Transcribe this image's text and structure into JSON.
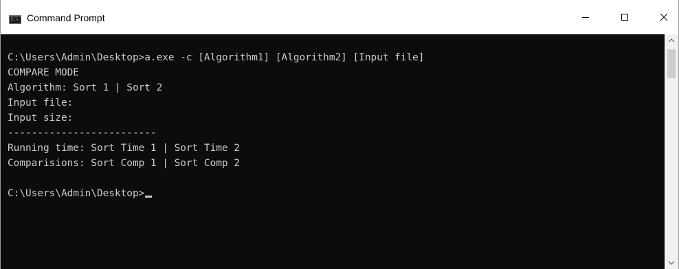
{
  "window": {
    "title": "Command Prompt",
    "icon": "console-icon",
    "icon_text": "C:\\",
    "controls": [
      "minimize-icon",
      "maximize-icon",
      "close-icon"
    ]
  },
  "console": {
    "lines": [
      "C:\\Users\\Admin\\Desktop>a.exe -c [Algorithm1] [Algorithm2] [Input file]",
      "COMPARE MODE",
      "Algorithm: Sort 1 | Sort 2",
      "Input file:",
      "Input size:",
      "-------------------------",
      "Running time: Sort Time 1 | Sort Time 2",
      "Comparisions: Sort Comp 1 | Sort Comp 2",
      "",
      "C:\\Users\\Admin\\Desktop>"
    ]
  },
  "colors": {
    "background": "#0c0c0c",
    "text": "#cccccc",
    "titlebar": "#ffffff"
  }
}
